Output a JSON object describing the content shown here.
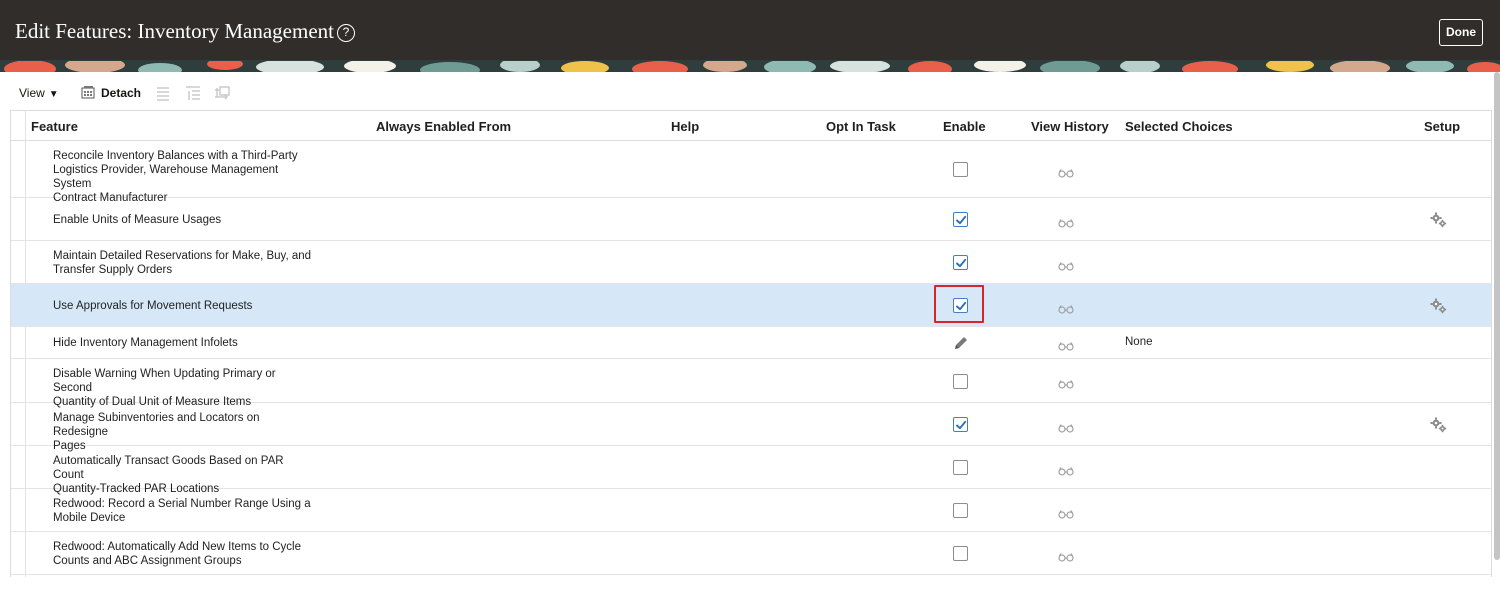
{
  "header": {
    "title": "Edit Features: Inventory Management",
    "help_glyph": "?",
    "done_label": "Done"
  },
  "toolbar": {
    "view_label": "View",
    "view_caret": "▼",
    "detach_label": "Detach"
  },
  "columns": {
    "feature": "Feature",
    "always_enabled_from": "Always Enabled From",
    "help": "Help",
    "opt_in_task": "Opt In Task",
    "enable": "Enable",
    "view_history": "View History",
    "selected_choices": "Selected Choices",
    "setup": "Setup"
  },
  "rows": [
    {
      "name": "Reconcile Inventory Balances with a Third-Party\nLogistics Provider, Warehouse Management System\nContract Manufacturer",
      "enable": "unchecked",
      "setup": false,
      "choice": ""
    },
    {
      "name": "Enable Units of Measure Usages",
      "enable": "checked",
      "setup": true,
      "choice": ""
    },
    {
      "name": "Maintain Detailed Reservations for Make, Buy, and\nTransfer Supply Orders",
      "enable": "checked",
      "setup": false,
      "choice": ""
    },
    {
      "name": "Use Approvals for Movement Requests",
      "enable": "checked",
      "setup": true,
      "choice": ""
    },
    {
      "name": "Hide Inventory Management Infolets",
      "enable": "edit",
      "setup": false,
      "choice": "None"
    },
    {
      "name": "Disable Warning When Updating Primary or Second\nQuantity of Dual Unit of Measure Items",
      "enable": "unchecked",
      "setup": false,
      "choice": ""
    },
    {
      "name": "Manage Subinventories and Locators on Redesigne\nPages",
      "enable": "checked",
      "setup": true,
      "choice": ""
    },
    {
      "name": "Automatically Transact Goods Based on PAR Count\nQuantity-Tracked PAR Locations",
      "enable": "unchecked",
      "setup": false,
      "choice": ""
    },
    {
      "name": "Redwood: Record a Serial Number Range Using a\nMobile Device",
      "enable": "unchecked",
      "setup": false,
      "choice": ""
    },
    {
      "name": "Redwood: Automatically Add New Items to Cycle\nCounts and ABC Assignment Groups",
      "enable": "unchecked",
      "setup": false,
      "choice": ""
    }
  ],
  "selected_row": 3,
  "colors": {
    "header_bg": "#312d2a",
    "selected_row_bg": "#d6e8f8",
    "highlight_border": "#d9232e",
    "checkbox_check": "#2d6cb5"
  },
  "icons": {
    "help": "help-circle-icon",
    "view_caret": "caret-down-icon",
    "detach": "detach-icon",
    "view_history": "glasses-icon",
    "setup": "gears-icon",
    "edit": "pencil-icon",
    "enable": "checkbox-icon"
  }
}
